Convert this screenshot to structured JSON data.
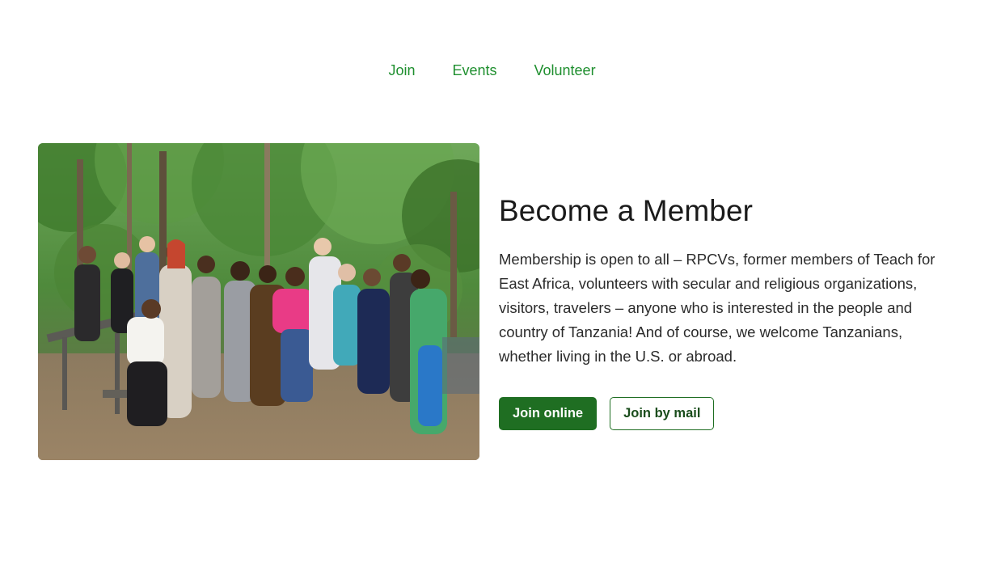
{
  "nav": {
    "items": [
      {
        "label": "Join"
      },
      {
        "label": "Events"
      },
      {
        "label": "Volunteer"
      }
    ]
  },
  "colors": {
    "nav_link": "#1f8f2f",
    "primary_button": "#1f6e22"
  },
  "member": {
    "heading": "Become a Member",
    "body": "Membership is open to all – RPCVs, former members of Teach for East Africa, volunteers with secular and religious organizations, visitors, travelers – anyone who is interested in the people and country of Tanzania! And of course, we welcome Tanzanians, whether living in the U.S. or abroad.",
    "join_online_label": "Join online",
    "join_by_mail_label": "Join by mail"
  }
}
